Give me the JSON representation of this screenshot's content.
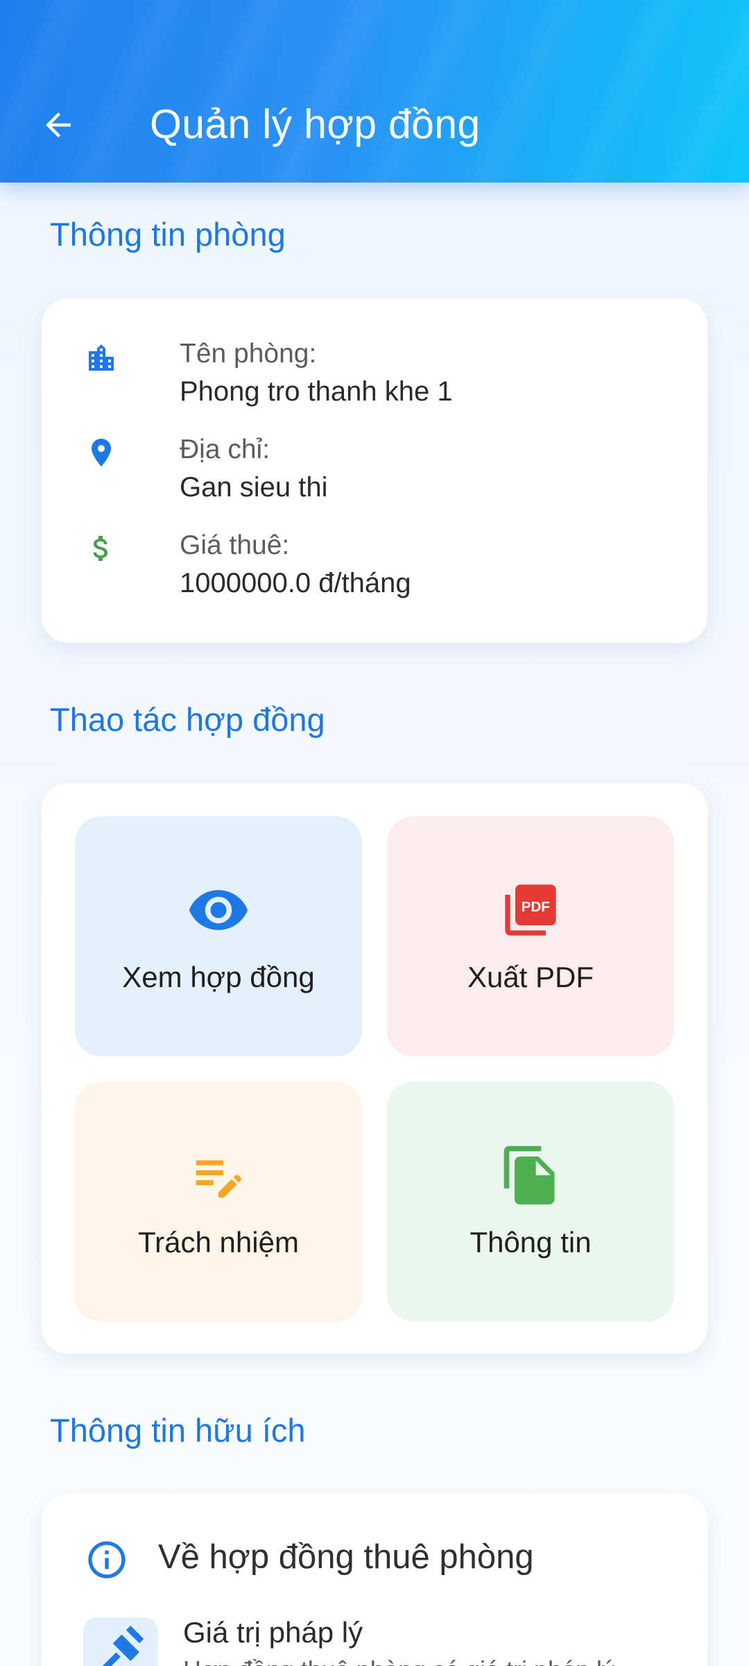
{
  "app_bar": {
    "title": "Quản lý hợp đồng",
    "back_icon": "arrow-back-icon"
  },
  "room_section": {
    "title": "Thông tin phòng",
    "rows": [
      {
        "icon": "building-icon",
        "icon_color": "#1e78e6",
        "label": "Tên phòng:",
        "value": "Phong tro thanh khe 1"
      },
      {
        "icon": "location-pin-icon",
        "icon_color": "#1e78e6",
        "label": "Địa chỉ:",
        "value": "Gan sieu thi"
      },
      {
        "icon": "dollar-icon",
        "icon_color": "#43a047",
        "label": "Giá thuê:",
        "value": "1000000.0 đ/tháng"
      }
    ]
  },
  "actions_section": {
    "title": "Thao tác hợp đồng",
    "tiles": [
      {
        "label": "Xem hợp đồng",
        "icon": "eye-icon",
        "icon_color": "#1e78e6",
        "bg": "#e5f0fd"
      },
      {
        "label": "Xuất PDF",
        "icon": "pdf-icon",
        "icon_color": "#e53935",
        "bg": "#fdeced"
      },
      {
        "label": "Trách nhiệm",
        "icon": "edit-note-icon",
        "icon_color": "#f5a623",
        "bg": "#fef5e8"
      },
      {
        "label": "Thông tin",
        "icon": "file-copy-icon",
        "icon_color": "#4caf50",
        "bg": "#ebf6ee"
      }
    ]
  },
  "useful_section": {
    "title": "Thông tin hữu ích",
    "about_title": "Về hợp đồng thuê phòng",
    "about_icon": "info-icon",
    "item_title": "Giá trị pháp lý",
    "item_icon": "gavel-icon",
    "item_desc": "Hợp đồng thuê phòng có giá trị pháp lý"
  },
  "colors": {
    "accent": "#1d78e2",
    "appbar_start": "#1e7ff0",
    "appbar_end": "#10c6fb"
  }
}
